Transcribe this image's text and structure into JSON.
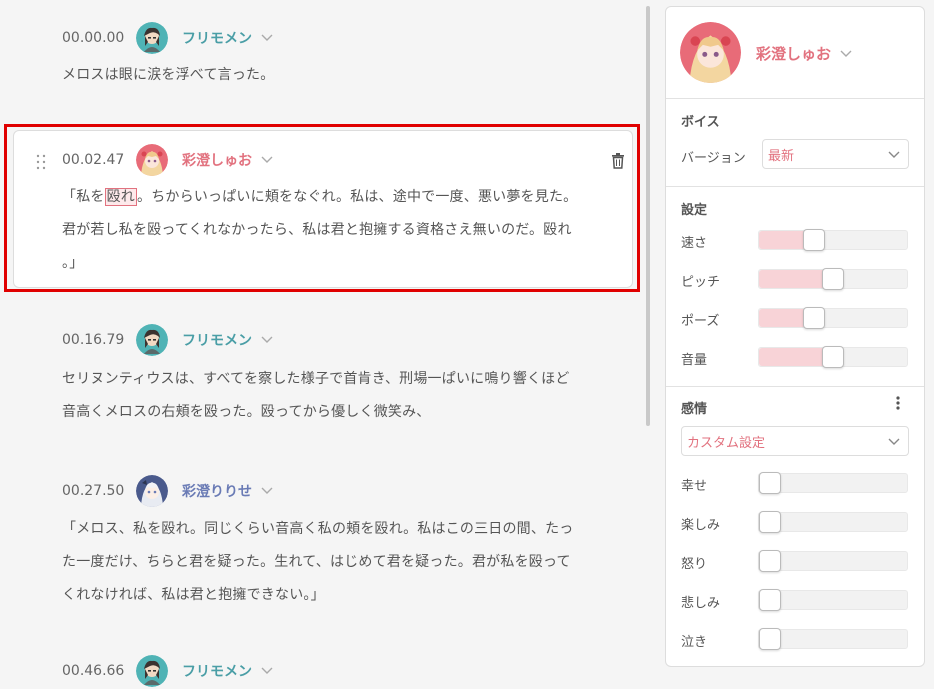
{
  "entries": [
    {
      "timestamp": "00.00.00",
      "speaker": "フリモメン",
      "avatar": "furimomen-avatar",
      "text": [
        "メロスは眼に涙を浮べて言った。"
      ]
    },
    {
      "timestamp": "00.02.47",
      "speaker": "彩澄しゅお",
      "avatar": "ayasumi-shuo-avatar",
      "text_prefix": "「私を",
      "text_highlight": "殴れ",
      "text_line1_rest": "。ちからいっぱいに頬をなぐれ。私は、途中で一度、悪い夢を見た。",
      "text_line2": "君が若し私を殴ってくれなかったら、私は君と抱擁する資格さえ無いのだ。殴れ",
      "text_line3": "。」"
    },
    {
      "timestamp": "00.16.79",
      "speaker": "フリモメン",
      "avatar": "furimomen-avatar",
      "text": [
        "セリヌンティウスは、すべてを察した様子で首肯き、刑場一ぱいに鳴り響くほど",
        "音高くメロスの右頬を殴った。殴ってから優しく微笑み、"
      ]
    },
    {
      "timestamp": "00.27.50",
      "speaker": "彩澄りりせ",
      "avatar": "ayasumi-ririse-avatar",
      "text": [
        "「メロス、私を殴れ。同じくらい音高く私の頬を殴れ。私はこの三日の間、たっ",
        "た一度だけ、ちらと君を疑った。生れて、はじめて君を疑った。君が私を殴って",
        "くれなければ、私は君と抱擁できない。」"
      ]
    },
    {
      "timestamp": "00.46.66",
      "speaker": "フリモメン",
      "avatar": "furimomen-avatar",
      "text": []
    }
  ],
  "panel": {
    "speaker": "彩澄しゅお",
    "voice_section": "ボイス",
    "version_label": "バージョン",
    "version_value": "最新",
    "settings_section": "設定",
    "sliders": [
      {
        "label": "速さ",
        "value": 0.35
      },
      {
        "label": "ピッチ",
        "value": 0.5
      },
      {
        "label": "ポーズ",
        "value": 0.35
      },
      {
        "label": "音量",
        "value": 0.5
      }
    ],
    "emotion_section": "感情",
    "emotion_preset": "カスタム設定",
    "emotions": [
      {
        "label": "幸せ",
        "value": 0
      },
      {
        "label": "楽しみ",
        "value": 0
      },
      {
        "label": "怒り",
        "value": 0
      },
      {
        "label": "悲しみ",
        "value": 0
      },
      {
        "label": "泣き",
        "value": 0
      }
    ]
  },
  "colors": {
    "accent_pink": "#e2727f",
    "teal": "#4a9ea6",
    "blue": "#6a7bb5",
    "selection_border": "#e00000"
  }
}
